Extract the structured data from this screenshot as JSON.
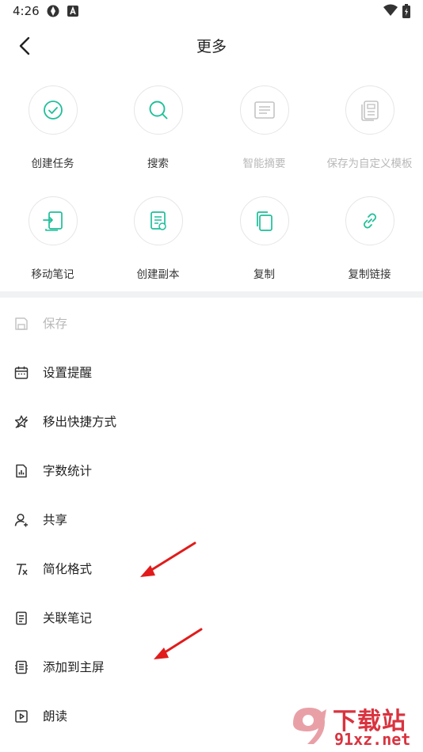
{
  "status_bar": {
    "time": "4:26"
  },
  "header": {
    "title": "更多"
  },
  "grid": [
    {
      "label": "创建任务",
      "icon": "check-circle-icon",
      "enabled": true
    },
    {
      "label": "搜索",
      "icon": "search-icon",
      "enabled": true
    },
    {
      "label": "智能摘要",
      "icon": "summary-icon",
      "enabled": false
    },
    {
      "label": "保存为自定义模板",
      "icon": "template-icon",
      "enabled": false
    },
    {
      "label": "移动笔记",
      "icon": "move-note-icon",
      "enabled": true
    },
    {
      "label": "创建副本",
      "icon": "duplicate-icon",
      "enabled": true
    },
    {
      "label": "复制",
      "icon": "copy-icon",
      "enabled": true
    },
    {
      "label": "复制链接",
      "icon": "link-icon",
      "enabled": true
    }
  ],
  "list": [
    {
      "label": "保存",
      "icon": "save-icon",
      "enabled": false
    },
    {
      "label": "设置提醒",
      "icon": "calendar-icon",
      "enabled": true
    },
    {
      "label": "移出快捷方式",
      "icon": "star-remove-icon",
      "enabled": true
    },
    {
      "label": "字数统计",
      "icon": "stats-document-icon",
      "enabled": true
    },
    {
      "label": "共享",
      "icon": "share-user-icon",
      "enabled": true
    },
    {
      "label": "简化格式",
      "icon": "clear-format-icon",
      "enabled": true
    },
    {
      "label": "关联笔记",
      "icon": "linked-note-icon",
      "enabled": true
    },
    {
      "label": "添加到主屏",
      "icon": "home-screen-icon",
      "enabled": true
    },
    {
      "label": "朗读",
      "icon": "play-icon",
      "enabled": true
    }
  ],
  "watermark": {
    "main": "下载站",
    "sub": "91xz.net"
  },
  "colors": {
    "accent": "#1fbf9a",
    "disabled": "#c4c4c4",
    "arrow": "#e11b1b",
    "watermark": "#d9333f"
  }
}
